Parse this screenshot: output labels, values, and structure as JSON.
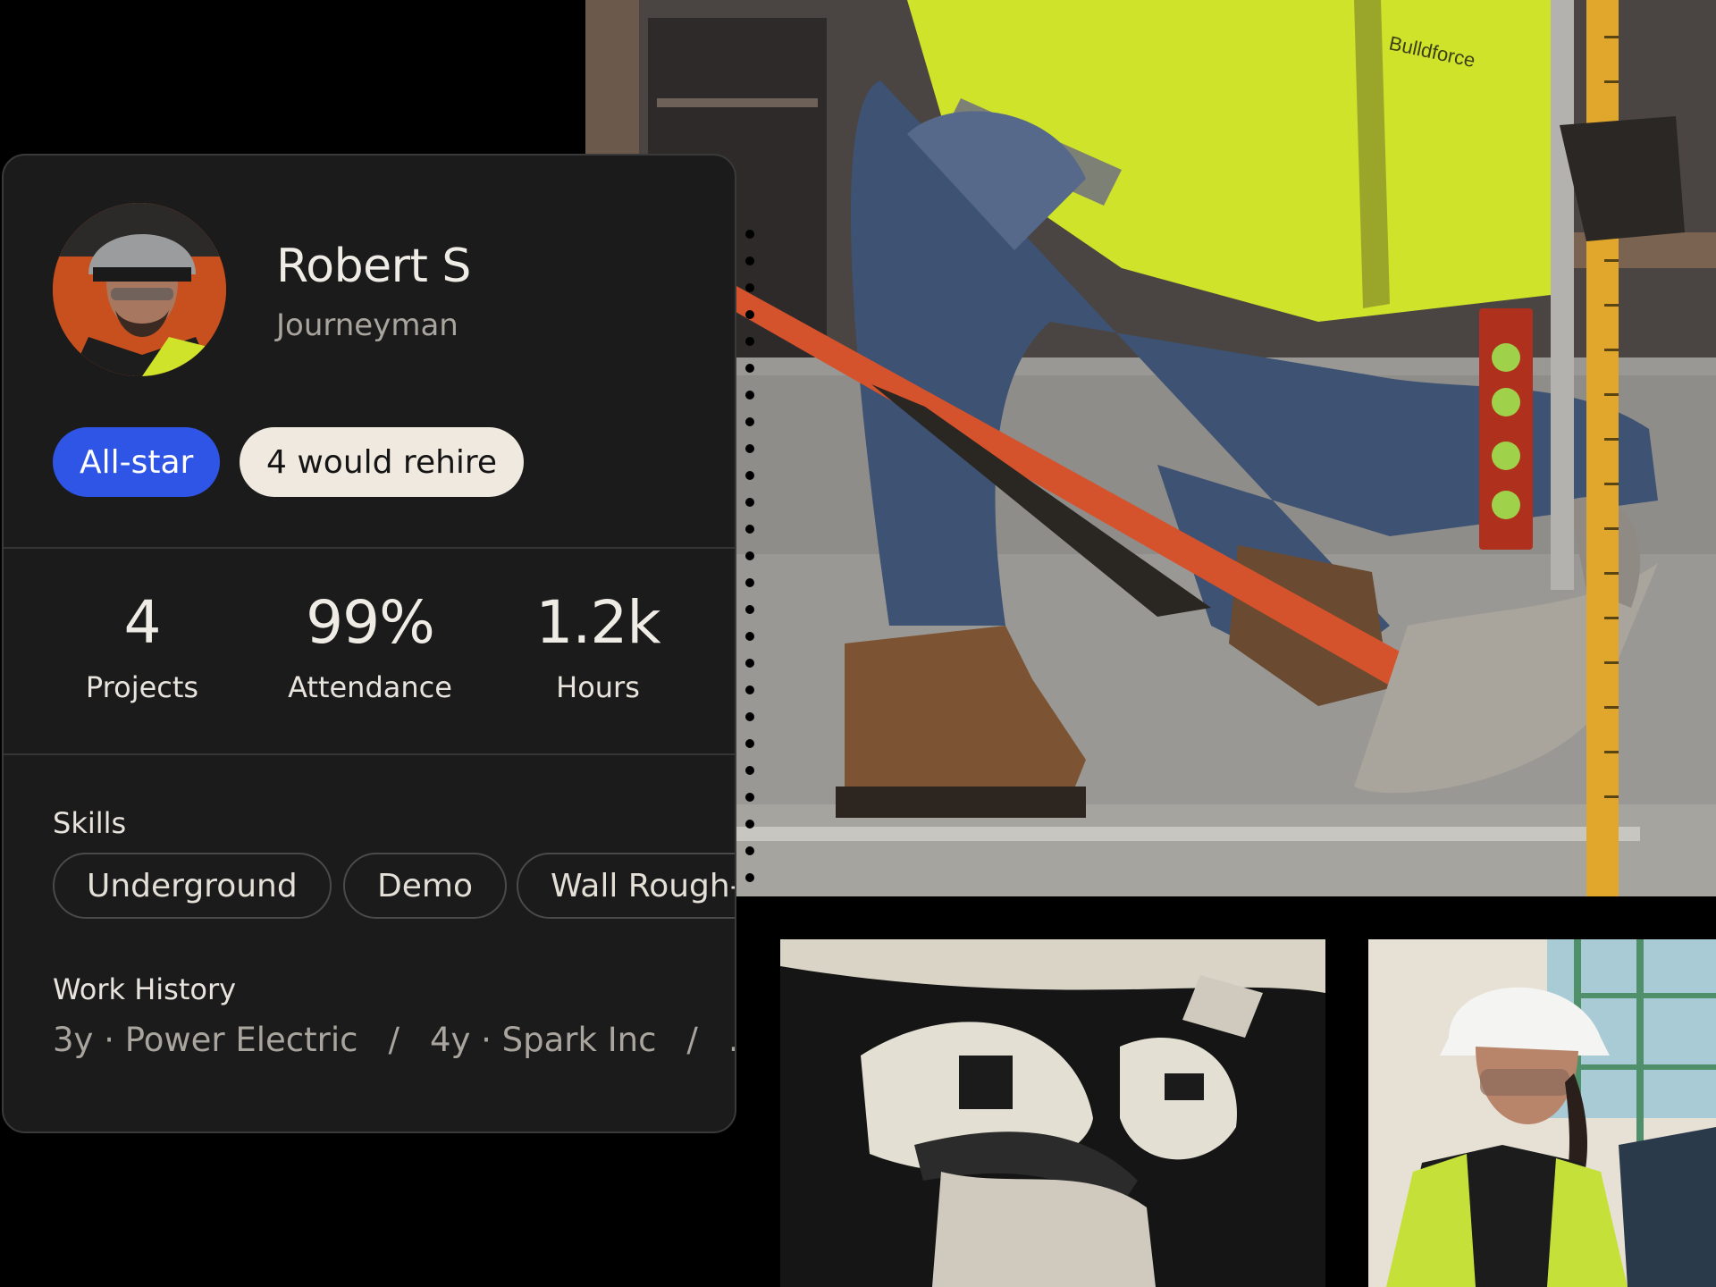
{
  "profile": {
    "name": "Robert S",
    "role": "Journeyman",
    "avatar": "worker-portrait"
  },
  "badges": {
    "allstar": "All-star",
    "rehire": "4 would rehire"
  },
  "stats": [
    {
      "value": "4",
      "label": "Projects"
    },
    {
      "value": "99%",
      "label": "Attendance"
    },
    {
      "value": "1.2k",
      "label": "Hours"
    }
  ],
  "skills": {
    "label": "Skills",
    "items": [
      "Underground",
      "Demo",
      "Wall Rough-in"
    ]
  },
  "work_history": {
    "label": "Work History",
    "entries": [
      "3y · Power Electric",
      "4y · Spark Inc",
      "..."
    ],
    "separator": "/"
  },
  "photos": {
    "main": {
      "vest_print": "Bulldforce"
    }
  },
  "colors": {
    "accent_blue": "#2f55e6",
    "card_bg": "#1b1b1b",
    "cream": "#efe9df",
    "safety_yellow": "#d7ec2a",
    "tool_orange": "#d5532c"
  }
}
